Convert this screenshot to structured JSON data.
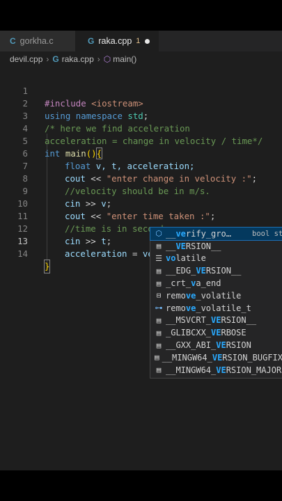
{
  "tabs": [
    {
      "label": "gorkha.c",
      "icon": "C",
      "active": false
    },
    {
      "label": "raka.cpp",
      "icon": "G",
      "badge": "1",
      "active": true
    }
  ],
  "breadcrumb": {
    "folder": "devil.cpp",
    "file": "raka.cpp",
    "symbol": "main()"
  },
  "code": {
    "line_numbers": [
      "1",
      "2",
      "3",
      "4",
      "5",
      "6",
      "7",
      "8",
      "9",
      "10",
      "11",
      "12",
      "13",
      "14"
    ],
    "l1": {
      "pp": "#include",
      "inc": "<iostream>"
    },
    "l2": {
      "kw1": "using",
      "kw2": "namespace",
      "id": "std",
      "end": ";"
    },
    "l3": {
      "comment": "/* here we find acceleration"
    },
    "l4": {
      "comment": "acceleration = change in velocity / time*/"
    },
    "l5": {
      "kw": "int",
      "fn": "main",
      "parens": "()",
      "brace": "{"
    },
    "l6": {
      "kw": "float",
      "rest": " v, t, acceleration;"
    },
    "l7": {
      "id": "cout",
      "op": " << ",
      "str": "\"enter change in velocity :\"",
      "end": ";"
    },
    "l8": {
      "comment": "//velocity should be in m/s."
    },
    "l9": {
      "id": "cin",
      "op": " >> ",
      "var": "v",
      "end": ";"
    },
    "l10": {
      "id": "cout",
      "op": " << ",
      "str": "\"enter time taken :\"",
      "end": ";"
    },
    "l11": {
      "comment": "//time is in second."
    },
    "l12": {
      "id": "cin",
      "op": " >> ",
      "var": "t",
      "end": ";"
    },
    "l13": {
      "var": "acceleration",
      "op": " = ",
      "typed": "ve"
    },
    "l14": {
      "brace": "}"
    }
  },
  "suggestions": [
    {
      "pre": "__",
      "match": "ve",
      "post": "rify_gro…",
      "icon": "cube-icon",
      "detail": "bool st"
    },
    {
      "pre": "__",
      "match": "VE",
      "post": "RSION__",
      "icon": "constant-icon"
    },
    {
      "pre": "",
      "match": "vo",
      "post": "latile",
      "icon": "keyword-icon"
    },
    {
      "pre": "__EDG_",
      "match": "VE",
      "post": "RSION__",
      "icon": "constant-icon"
    },
    {
      "pre": "_crt_",
      "match": "v",
      "post": "a_end",
      "icon": "constant-icon"
    },
    {
      "pre": "remo",
      "match": "ve",
      "post": "_volatile",
      "icon": "struct-icon"
    },
    {
      "pre": "remo",
      "match": "ve",
      "post": "_volatile_t",
      "icon": "typedef-icon"
    },
    {
      "pre": "__MSVCRT_",
      "match": "VE",
      "post": "RSION__",
      "icon": "constant-icon"
    },
    {
      "pre": "_GLIBCXX_",
      "match": "VE",
      "post": "RBOSE",
      "icon": "constant-icon"
    },
    {
      "pre": "__GXX_ABI_",
      "match": "VE",
      "post": "RSION",
      "icon": "constant-icon"
    },
    {
      "pre": "__MINGW64_",
      "match": "VE",
      "post": "RSION_BUGFIX",
      "icon": "constant-icon"
    },
    {
      "pre": "__MINGW64_",
      "match": "VE",
      "post": "RSION_MAJOR",
      "icon": "constant-icon"
    }
  ],
  "colors": {
    "background": "#1e1e1e",
    "selection": "#04395e",
    "match": "#2aaaff"
  }
}
